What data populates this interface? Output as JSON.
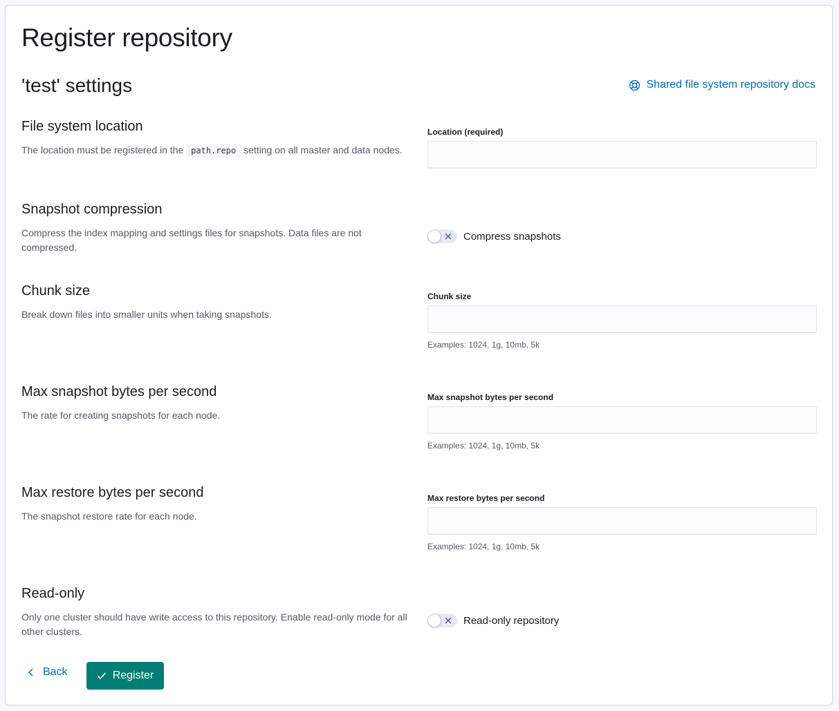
{
  "page": {
    "title": "Register repository"
  },
  "settings": {
    "title": "'test' settings"
  },
  "docs_link": {
    "label": "Shared file system repository docs",
    "icon": "help-lifebuoy-icon",
    "color": "#006bb8"
  },
  "location": {
    "title": "File system location",
    "desc_before": "The location must be registered in the",
    "code": "path.repo",
    "desc_after": "setting on all master and data nodes.",
    "field_label": "Location (required)",
    "value": ""
  },
  "compression": {
    "title": "Snapshot compression",
    "desc": "Compress the index mapping and settings files for snapshots. Data files are not compressed.",
    "switch_label": "Compress snapshots",
    "checked": false
  },
  "chunk": {
    "title": "Chunk size",
    "desc": "Break down files into smaller units when taking snapshots.",
    "field_label": "Chunk size",
    "help": "Examples: 1024, 1g, 10mb, 5k",
    "value": ""
  },
  "max_snapshot": {
    "title": "Max snapshot bytes per second",
    "desc": "The rate for creating snapshots for each node.",
    "field_label": "Max snapshot bytes per second",
    "help": "Examples: 1024, 1g, 10mb, 5k",
    "value": ""
  },
  "max_restore": {
    "title": "Max restore bytes per second",
    "desc": "The snapshot restore rate for each node.",
    "field_label": "Max restore bytes per second",
    "help": "Examples: 1024, 1g, 10mb, 5k",
    "value": ""
  },
  "readonly": {
    "title": "Read-only",
    "desc": "Only one cluster should have write access to this repository. Enable read-only mode for all other clusters.",
    "switch_label": "Read-only repository",
    "checked": false
  },
  "actions": {
    "back_label": "Back",
    "register_label": "Register",
    "primary_color": "#017d73"
  }
}
